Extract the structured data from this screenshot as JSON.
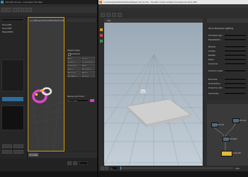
{
  "left_window": {
    "title": "3ds Max Scene - Autodesk 3ds Max",
    "create_panel": {
      "object_type_label": "Object Type",
      "autogrid_label": "AutoGrid",
      "object_buttons": [
        "Box",
        "Cone",
        "Sphere",
        "GeoSphere",
        "Cylinder",
        "Tube",
        "Torus",
        "Pyramid",
        "Teapot",
        "Plane",
        "TextPlus",
        "Hedra"
      ],
      "name_color_label": "Name and Color",
      "name_value": "Torus001"
    },
    "viewport": {
      "label": "[+] [Perspective] [Standard] [Default Shading]"
    },
    "scene_explorer": {
      "items": [
        "Torus001",
        "Torus002",
        "Teapot001"
      ]
    },
    "timeline": {
      "range": "0 / 100"
    }
  },
  "right_window": {
    "title": "C:/Users/publish/Desktop/Teapot_Torus.hip - Houdini Indie Limited-Commercial 19.0.383",
    "viewport": {
      "toolbar_label": "obj"
    },
    "parameters": {
      "header": "Torus Polysoup Lighting",
      "rows": [
        "Primitive Type",
        "Tessellation",
        "Radius",
        "Center",
        "Rotate",
        "Rows",
        "Columns",
        "Uniform Scale",
        "Normals",
        "Orientation",
        "Orient by Orient",
        "Geometry"
      ]
    },
    "network": {
      "nodes": [
        "torus1",
        "xform1",
        "merge1",
        "output0"
      ]
    },
    "timeline": {
      "frame": "1",
      "end": "240"
    }
  }
}
